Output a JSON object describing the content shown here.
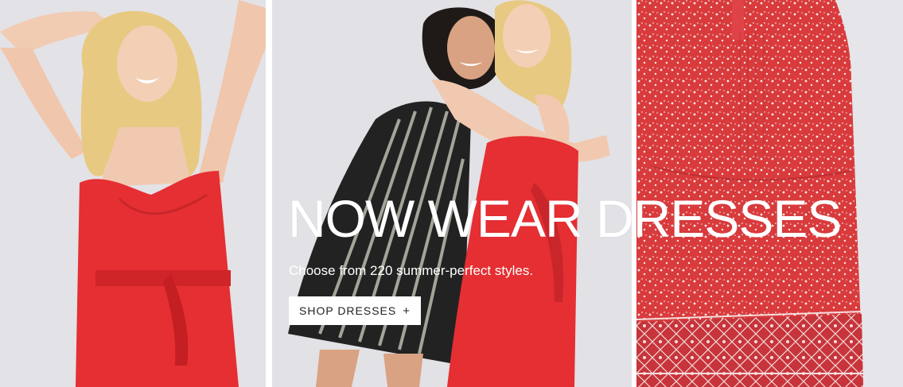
{
  "hero": {
    "headline": "NOW WEAR DRESSES",
    "subtext": "Choose from 220 summer-perfect styles.",
    "cta_label": "SHOP DRESSES",
    "cta_icon": "+",
    "colors": {
      "backdrop": "#e6e5e9",
      "dress_red": "#e52f33",
      "print_red": "#d93b3d",
      "stripe_black": "#222222",
      "skin": "#f1c9b0",
      "hair_blonde": "#e8c981",
      "hair_dark": "#1f1a18",
      "text": "#ffffff"
    }
  }
}
